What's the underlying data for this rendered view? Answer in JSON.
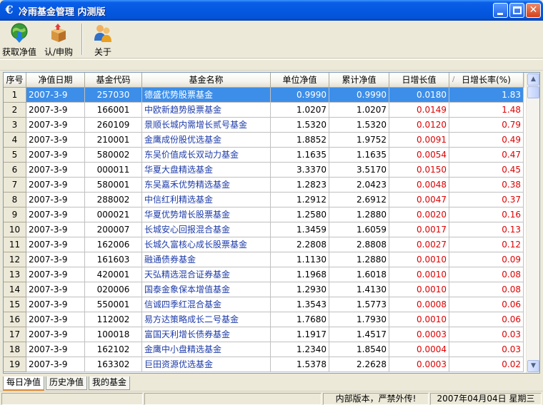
{
  "window": {
    "title": "冷雨基金管理  内测版",
    "app_icon": "€"
  },
  "toolbar": {
    "fetch_label": "获取净值",
    "subscribe_label": "认/申购",
    "about_label": "关于"
  },
  "table": {
    "columns": [
      "序号",
      "净值日期",
      "基金代码",
      "基金名称",
      "单位净值",
      "累计净值",
      "日增长值",
      "日增长率(%)"
    ],
    "rows": [
      [
        "1",
        "2007-3-9",
        "257030",
        "德盛优势股票基金",
        "0.9990",
        "0.9990",
        "0.0180",
        "1.83"
      ],
      [
        "2",
        "2007-3-9",
        "166001",
        "中欧新趋势股票基金",
        "1.0207",
        "1.0207",
        "0.0149",
        "1.48"
      ],
      [
        "3",
        "2007-3-9",
        "260109",
        "景顺长城内需增长贰号基金",
        "1.5320",
        "1.5320",
        "0.0120",
        "0.79"
      ],
      [
        "4",
        "2007-3-9",
        "210001",
        "金鹰成份股优选基金",
        "1.8852",
        "1.9752",
        "0.0091",
        "0.49"
      ],
      [
        "5",
        "2007-3-9",
        "580002",
        "东吴价值成长双动力基金",
        "1.1635",
        "1.1635",
        "0.0054",
        "0.47"
      ],
      [
        "6",
        "2007-3-9",
        "000011",
        "华夏大盘精选基金",
        "3.3370",
        "3.5170",
        "0.0150",
        "0.45"
      ],
      [
        "7",
        "2007-3-9",
        "580001",
        "东吴嘉禾优势精选基金",
        "1.2823",
        "2.0423",
        "0.0048",
        "0.38"
      ],
      [
        "8",
        "2007-3-9",
        "288002",
        "中信红利精选基金",
        "1.2912",
        "2.6912",
        "0.0047",
        "0.37"
      ],
      [
        "9",
        "2007-3-9",
        "000021",
        "华夏优势增长股票基金",
        "1.2580",
        "1.2880",
        "0.0020",
        "0.16"
      ],
      [
        "10",
        "2007-3-9",
        "200007",
        "长城安心回报混合基金",
        "1.3459",
        "1.6059",
        "0.0017",
        "0.13"
      ],
      [
        "11",
        "2007-3-9",
        "162006",
        "长城久富核心成长股票基金",
        "2.2808",
        "2.8808",
        "0.0027",
        "0.12"
      ],
      [
        "12",
        "2007-3-9",
        "161603",
        "融通债券基金",
        "1.1130",
        "1.2880",
        "0.0010",
        "0.09"
      ],
      [
        "13",
        "2007-3-9",
        "420001",
        "天弘精选混合证券基金",
        "1.1968",
        "1.6018",
        "0.0010",
        "0.08"
      ],
      [
        "14",
        "2007-3-9",
        "020006",
        "国泰金象保本增值基金",
        "1.2930",
        "1.4130",
        "0.0010",
        "0.08"
      ],
      [
        "15",
        "2007-3-9",
        "550001",
        "信诚四季红混合基金",
        "1.3543",
        "1.5773",
        "0.0008",
        "0.06"
      ],
      [
        "16",
        "2007-3-9",
        "112002",
        "易方达策略成长二号基金",
        "1.7680",
        "1.7930",
        "0.0010",
        "0.06"
      ],
      [
        "17",
        "2007-3-9",
        "100018",
        "富国天利增长债券基金",
        "1.1917",
        "1.4517",
        "0.0003",
        "0.03"
      ],
      [
        "18",
        "2007-3-9",
        "162102",
        "金鹰中小盘精选基金",
        "1.2340",
        "1.8540",
        "0.0004",
        "0.03"
      ],
      [
        "19",
        "2007-3-9",
        "163302",
        "巨田资源优选基金",
        "1.5378",
        "2.2628",
        "0.0003",
        "0.02"
      ]
    ],
    "selected_row": 0,
    "sort_indicator": "/"
  },
  "tabs": [
    "每日净值",
    "历史净值",
    "我的基金"
  ],
  "status": {
    "panel1": "",
    "panel2": "",
    "notice": "内部版本，严禁外传!",
    "date": "2007年04月04日  星期三"
  },
  "colors": {
    "accent": "#0558e0",
    "selection": "#3d8ee8",
    "positive": "#e00000"
  }
}
